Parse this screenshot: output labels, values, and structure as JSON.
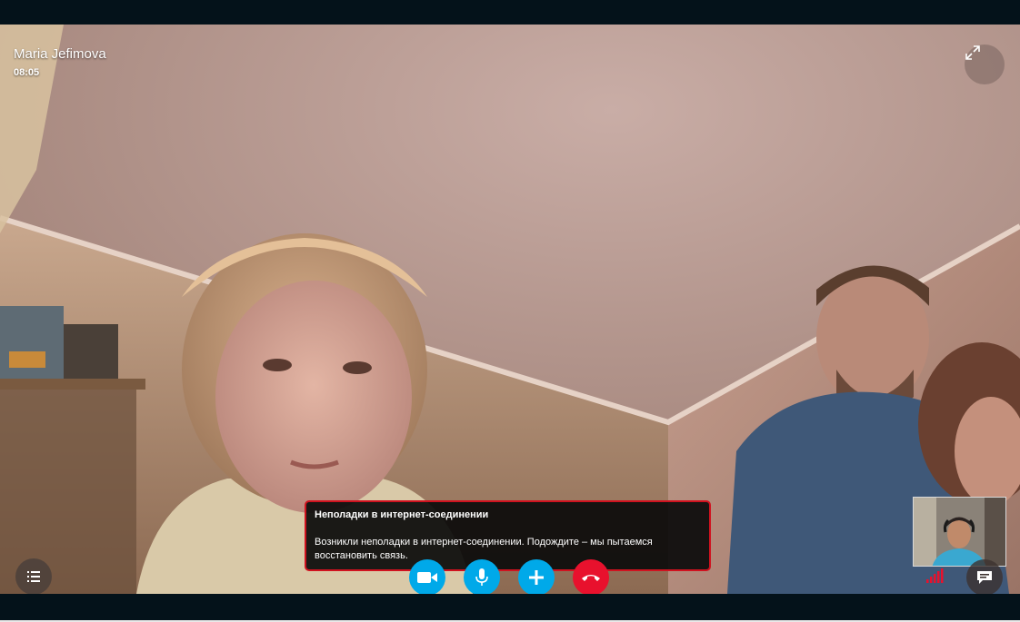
{
  "call": {
    "caller_name": "Maria Jefimova",
    "timer": "08:05"
  },
  "toast": {
    "title": "Неполадки в интернет-соединении",
    "body": "Возникли неполадки в интернет-соединении. Подождите – мы пытаемся восстановить связь."
  },
  "controls": {
    "video": "video-camera-icon",
    "mic": "microphone-icon",
    "add": "plus-icon",
    "end": "hang-up-icon",
    "list": "list-icon",
    "chat": "chat-icon",
    "fullscreen": "expand-icon",
    "signal": "signal-bars-icon"
  },
  "colors": {
    "accent_blue": "#00a9e9",
    "end_call_red": "#e8112d",
    "warning_border": "#d0121f",
    "signal_red": "#e8112d"
  },
  "signal": {
    "bars_total": 5,
    "level": 1
  }
}
